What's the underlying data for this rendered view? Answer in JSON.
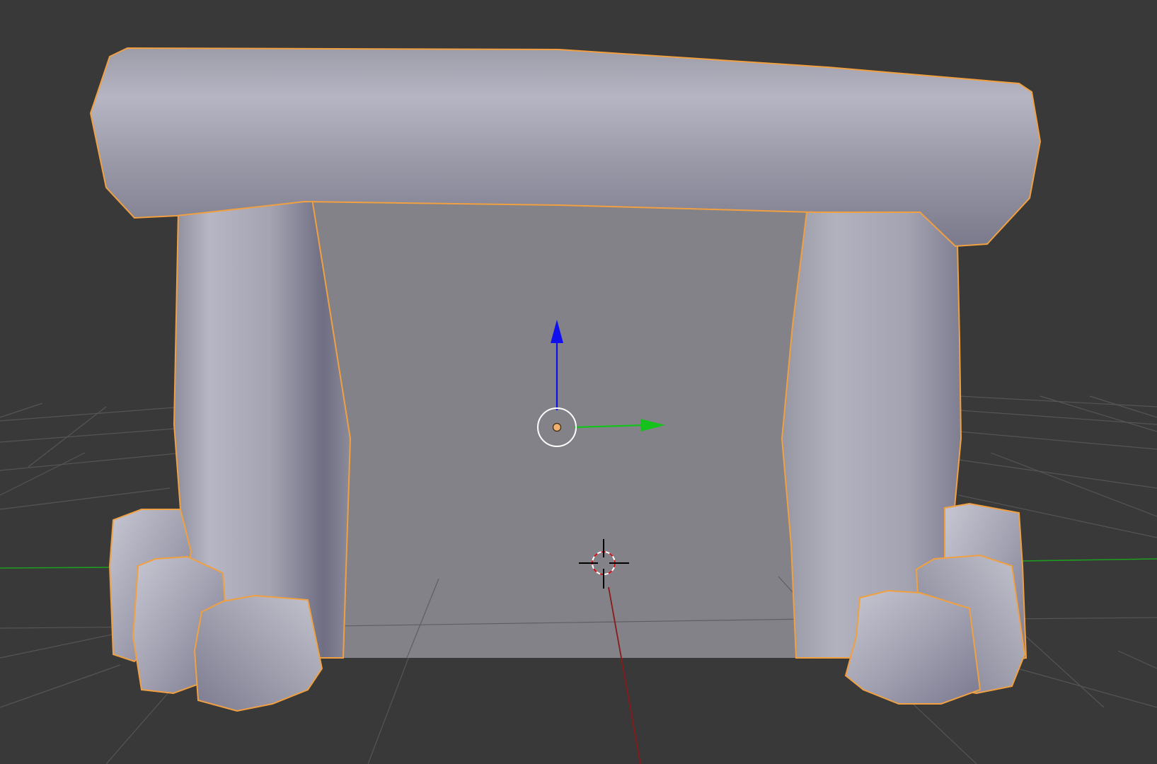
{
  "viewport": {
    "background": "#393939",
    "grid_color": "#555555",
    "axis_x_color": "#8a1a1a",
    "axis_y_color": "#1e9e1e",
    "selection_outline_color": "#f0a040",
    "mesh_color": "#a9a8b6",
    "mesh_inner_color": "#838288"
  },
  "gizmo": {
    "z_arrow_color": "#1010ee",
    "y_arrow_color": "#15c21b",
    "origin_color": "#f0b070",
    "pivot_ring_color": "#ffffff"
  },
  "cursor_3d": {
    "ring_color_a": "#d01010",
    "ring_color_b": "#ffffff",
    "crosshair_color": "#000000"
  },
  "scene_object": {
    "icon": "dolmen-mesh-icon",
    "selected": true
  }
}
